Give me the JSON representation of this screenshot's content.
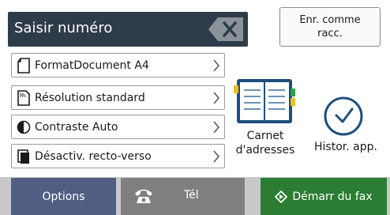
{
  "input": {
    "label": "Saisir numéro"
  },
  "shortcut_button": {
    "line1": "Enr. comme",
    "line2": "racc."
  },
  "settings": [
    {
      "label": "FormatDocument A4",
      "icon": "document-icon"
    },
    {
      "label": "Résolution standard",
      "icon": "resolution-icon"
    },
    {
      "label": "Contraste Auto",
      "icon": "contrast-icon"
    },
    {
      "label": "Désactiv. recto-verso",
      "icon": "duplex-icon"
    }
  ],
  "address_book": {
    "line1": "Carnet",
    "line2": "d'adresses",
    "icon": "address-book-icon"
  },
  "history": {
    "label": "Histor. app.",
    "icon": "clock-icon"
  },
  "bottom": {
    "options_label": "Options",
    "tel_label": "Tél",
    "fax_label": "Démarr du fax"
  },
  "colors": {
    "input_bar": "#2e3b49",
    "options_button": "#4f5e82",
    "tel_button": "#7f7f7f",
    "fax_button": "#2a7d32",
    "bottom_bar": "#c8c8c8"
  }
}
